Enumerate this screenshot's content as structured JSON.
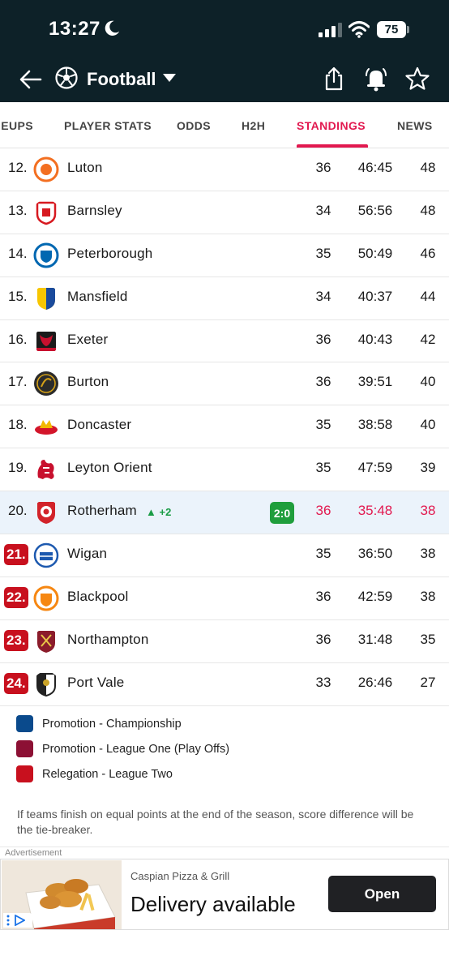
{
  "status_bar": {
    "time": "13:27",
    "battery": "75"
  },
  "header": {
    "title": "Football"
  },
  "tabs": [
    {
      "label": "IEUPS",
      "active": false
    },
    {
      "label": "PLAYER STATS",
      "active": false
    },
    {
      "label": "ODDS",
      "active": false
    },
    {
      "label": "H2H",
      "active": false
    },
    {
      "label": "STANDINGS",
      "active": true
    },
    {
      "label": "NEWS",
      "active": false
    }
  ],
  "standings": [
    {
      "pos": "12.",
      "team": "Luton",
      "played": "36",
      "diff": "46:45",
      "pts": "48",
      "crest_color": "#f36f21",
      "zone": ""
    },
    {
      "pos": "13.",
      "team": "Barnsley",
      "played": "34",
      "diff": "56:56",
      "pts": "48",
      "crest_color": "#d71920",
      "zone": ""
    },
    {
      "pos": "14.",
      "team": "Peterborough",
      "played": "35",
      "diff": "50:49",
      "pts": "46",
      "crest_color": "#0067b1",
      "zone": ""
    },
    {
      "pos": "15.",
      "team": "Mansfield",
      "played": "34",
      "diff": "40:37",
      "pts": "44",
      "crest_color": "#f7c600",
      "zone": ""
    },
    {
      "pos": "16.",
      "team": "Exeter",
      "played": "36",
      "diff": "40:43",
      "pts": "42",
      "crest_color": "#c8102e",
      "zone": ""
    },
    {
      "pos": "17.",
      "team": "Burton",
      "played": "36",
      "diff": "39:51",
      "pts": "40",
      "crest_color": "#2b2b2b",
      "zone": ""
    },
    {
      "pos": "18.",
      "team": "Doncaster",
      "played": "35",
      "diff": "38:58",
      "pts": "40",
      "crest_color": "#d3152a",
      "zone": ""
    },
    {
      "pos": "19.",
      "team": "Leyton Orient",
      "played": "35",
      "diff": "47:59",
      "pts": "39",
      "crest_color": "#c8102e",
      "zone": ""
    },
    {
      "pos": "20.",
      "team": "Rotherham",
      "played": "36",
      "diff": "35:48",
      "pts": "38",
      "crest_color": "#d2232a",
      "zone": "",
      "movement": "+2",
      "live_score": "2:0"
    },
    {
      "pos": "21.",
      "team": "Wigan",
      "played": "35",
      "diff": "36:50",
      "pts": "38",
      "crest_color": "#1d59af",
      "zone": "relegation"
    },
    {
      "pos": "22.",
      "team": "Blackpool",
      "played": "36",
      "diff": "42:59",
      "pts": "38",
      "crest_color": "#f68712",
      "zone": "relegation"
    },
    {
      "pos": "23.",
      "team": "Northampton",
      "played": "36",
      "diff": "31:48",
      "pts": "35",
      "crest_color": "#8b1c2b",
      "zone": "relegation"
    },
    {
      "pos": "24.",
      "team": "Port Vale",
      "played": "33",
      "diff": "26:46",
      "pts": "27",
      "crest_color": "#222222",
      "zone": "relegation"
    }
  ],
  "legend": [
    {
      "label": "Promotion - Championship",
      "color": "#0a4a8c"
    },
    {
      "label": "Promotion - League One (Play Offs)",
      "color": "#8c1034"
    },
    {
      "label": "Relegation - League Two",
      "color": "#c8101e"
    }
  ],
  "note": "If teams finish on equal points at the end of the season, score difference will be the tie-breaker.",
  "ad": {
    "label": "Advertisement",
    "brand": "Caspian Pizza & Grill",
    "headline": "Delivery available",
    "button": "Open"
  },
  "colors": {
    "header_bg": "#0d2128",
    "accent": "#e2184f",
    "relegation": "#c8101e",
    "live": "#1f9e3c",
    "highlight_row": "#ebf3fb"
  }
}
